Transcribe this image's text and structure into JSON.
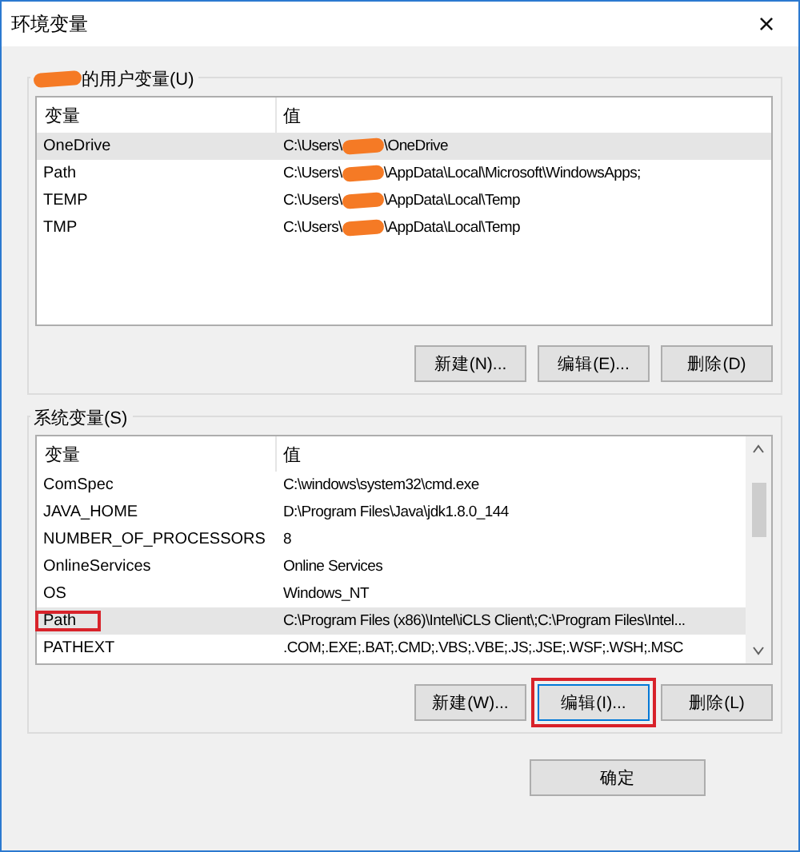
{
  "window": {
    "title": "环境变量",
    "close": "×"
  },
  "user_group": {
    "owner_redacted": true,
    "label": "的用户变量(U)",
    "columns": [
      "变量",
      "值"
    ],
    "rows": [
      {
        "name": "OneDrive",
        "value_before": "C:\\Users\\",
        "redacted": true,
        "value_after": "\\OneDrive",
        "selected": true,
        "highlighted": false
      },
      {
        "name": "Path",
        "value_before": "C:\\Users\\",
        "redacted": true,
        "value_after": "\\AppData\\Local\\Microsoft\\WindowsApps;",
        "selected": false,
        "highlighted": false
      },
      {
        "name": "TEMP",
        "value_before": "C:\\Users\\",
        "redacted": true,
        "value_after": "\\AppData\\Local\\Temp",
        "selected": false,
        "highlighted": false
      },
      {
        "name": "TMP",
        "value_before": "C:\\Users\\",
        "redacted": true,
        "value_after": "\\AppData\\Local\\Temp",
        "selected": false,
        "highlighted": false
      }
    ],
    "buttons": [
      {
        "label": "新建(N)...",
        "highlighted": false
      },
      {
        "label": "编辑(E)...",
        "highlighted": false
      },
      {
        "label": "删除(D)",
        "highlighted": false
      }
    ]
  },
  "system_group": {
    "label": "系统变量(S)",
    "columns": [
      "变量",
      "值"
    ],
    "rows": [
      {
        "name": "ComSpec",
        "value_before": "C:\\windows\\system32\\cmd.exe",
        "redacted": false,
        "selected": false,
        "highlighted": false
      },
      {
        "name": "JAVA_HOME",
        "value_before": "D:\\Program Files\\Java\\jdk1.8.0_144",
        "redacted": false,
        "selected": false,
        "highlighted": false
      },
      {
        "name": "NUMBER_OF_PROCESSORS",
        "value_before": "8",
        "redacted": false,
        "selected": false,
        "highlighted": false
      },
      {
        "name": "OnlineServices",
        "value_before": "Online Services",
        "redacted": false,
        "selected": false,
        "highlighted": false
      },
      {
        "name": "OS",
        "value_before": "Windows_NT",
        "redacted": false,
        "selected": false,
        "highlighted": false
      },
      {
        "name": "Path",
        "value_before": "C:\\Program Files (x86)\\Intel\\iCLS Client\\;C:\\Program Files\\Intel...",
        "redacted": false,
        "selected": true,
        "highlighted": true
      },
      {
        "name": "PATHEXT",
        "value_before": ".COM;.EXE;.BAT;.CMD;.VBS;.VBE;.JS;.JSE;.WSF;.WSH;.MSC",
        "redacted": false,
        "selected": false,
        "highlighted": false
      }
    ],
    "buttons": [
      {
        "label": "新建(W)...",
        "highlighted": false
      },
      {
        "label": "编辑(I)...",
        "highlighted": true
      },
      {
        "label": "删除(L)",
        "highlighted": false
      }
    ]
  },
  "footer_buttons": [
    "确定"
  ]
}
